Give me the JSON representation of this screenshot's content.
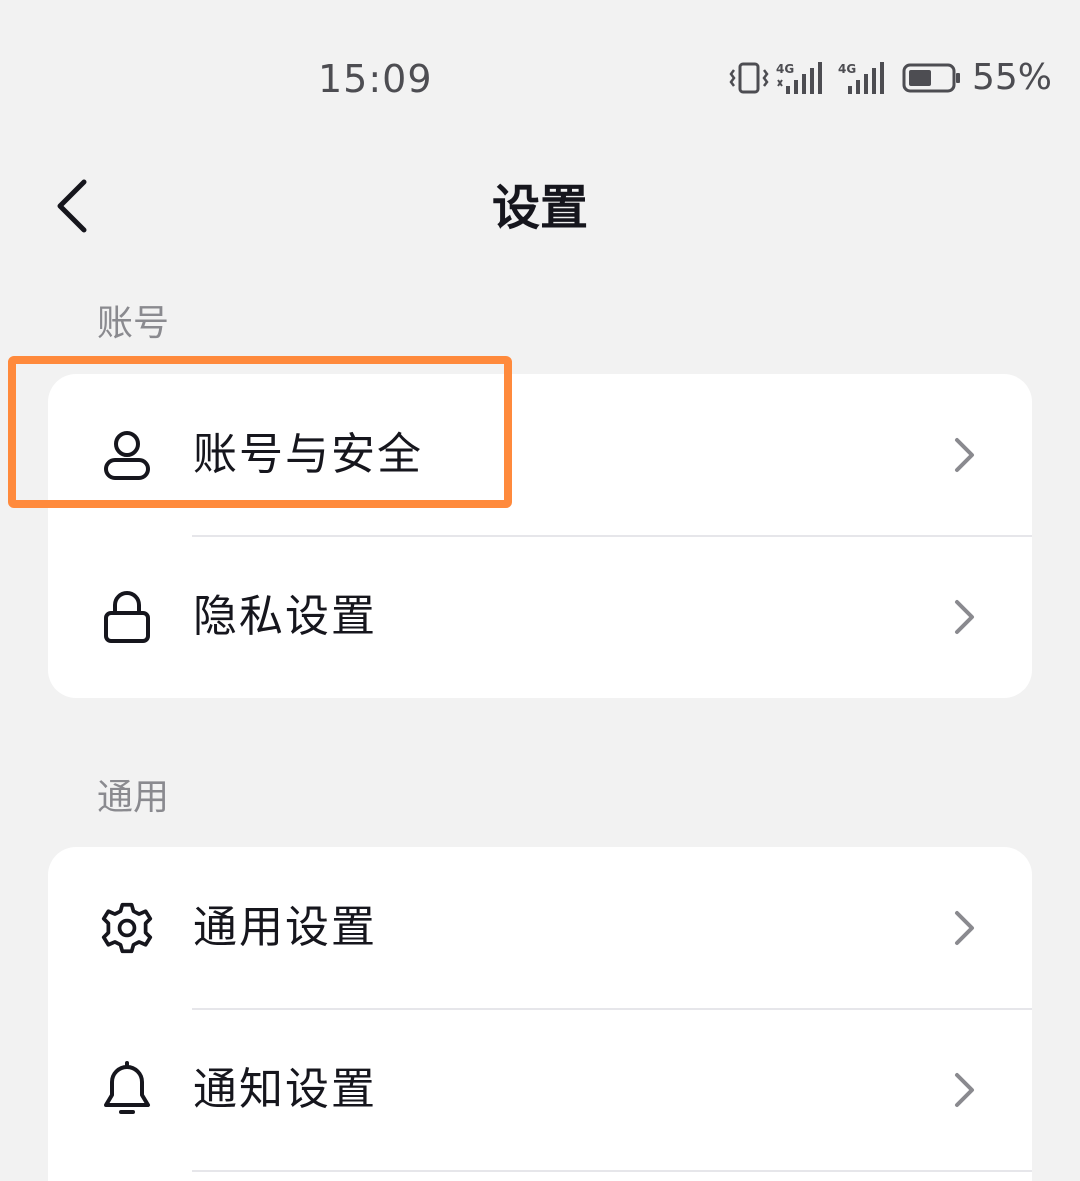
{
  "status_bar": {
    "time": "15:09",
    "icons": [
      "vibrate-icon",
      "signal-4g-1-icon",
      "signal-4g-2-icon",
      "battery-icon"
    ],
    "signal_1_label": "4G",
    "signal_2_label": "4G",
    "battery_level": 0.55,
    "battery_percent": "55%"
  },
  "header": {
    "back_icon": "chevron-left-icon",
    "title": "设置"
  },
  "sections": [
    {
      "label": "账号",
      "items": [
        {
          "label": "账号与安全",
          "icon": "user-icon",
          "highlighted": true
        },
        {
          "label": "隐私设置",
          "icon": "lock-icon"
        }
      ]
    },
    {
      "label": "通用",
      "items": [
        {
          "label": "通用设置",
          "icon": "gear-icon"
        },
        {
          "label": "通知设置",
          "icon": "bell-icon"
        }
      ]
    }
  ],
  "colors": {
    "background": "#f2f2f2",
    "card": "#ffffff",
    "text": "#16161d",
    "secondary_text": "#8a8a8f",
    "chevron": "#8a8a8f",
    "highlight": "#ff8a3c"
  }
}
